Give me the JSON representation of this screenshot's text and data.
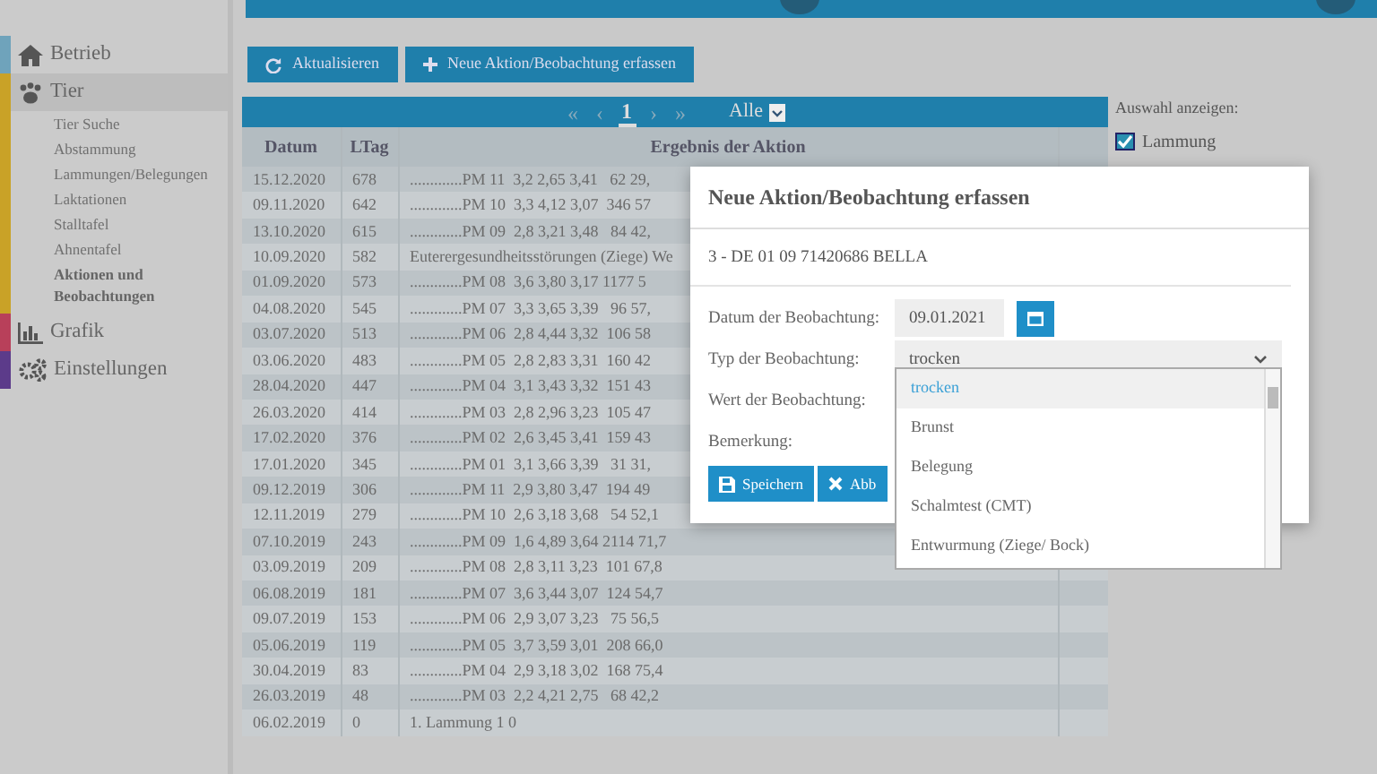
{
  "sidebar": {
    "items": [
      {
        "label": "Betrieb",
        "color": "#6fa3bb",
        "selected": false
      },
      {
        "label": "Tier",
        "color": "#c9a227",
        "selected": true,
        "children": [
          {
            "label": "Tier Suche",
            "selected": false
          },
          {
            "label": "Abstammung",
            "selected": false
          },
          {
            "label": "Lammungen/Belegungen",
            "selected": false
          },
          {
            "label": "Laktationen",
            "selected": false
          },
          {
            "label": "Stalltafel",
            "selected": false
          },
          {
            "label": "Ahnentafel",
            "selected": false
          },
          {
            "label": "Aktionen und Beobachtungen",
            "selected": true
          }
        ]
      },
      {
        "label": "Grafik",
        "color": "#b8405a",
        "selected": false
      },
      {
        "label": "Einstellungen",
        "color": "#5c3b8a",
        "selected": false
      }
    ]
  },
  "toolbar": [
    {
      "label": "Aktualisieren"
    },
    {
      "label": "Neue Aktion/Beobachtung erfassen"
    }
  ],
  "pager": {
    "buttons": [
      {
        "label": "«",
        "selected": false
      },
      {
        "label": "‹",
        "selected": false
      },
      {
        "label": "1",
        "selected": true
      },
      {
        "label": "›",
        "selected": false
      },
      {
        "label": "»",
        "selected": false
      }
    ],
    "filter": "Alle"
  },
  "table": {
    "columns": [
      "Datum",
      "LTag",
      "Ergebnis der Aktion"
    ],
    "rows": [
      [
        "15.12.2020",
        "678",
        ".............PM 11  3,2 2,65 3,41   62 29,"
      ],
      [
        "09.11.2020",
        "642",
        ".............PM 10  3,3 4,12 3,07  346 57"
      ],
      [
        "13.10.2020",
        "615",
        ".............PM 09  2,8 3,21 3,48   84 42,"
      ],
      [
        "10.09.2020",
        "582",
        "Euterergesundheitsstörungen (Ziege) We"
      ],
      [
        "01.09.2020",
        "573",
        ".............PM 08  3,6 3,80 3,17 1177 5"
      ],
      [
        "04.08.2020",
        "545",
        ".............PM 07  3,3 3,65 3,39   96 57,"
      ],
      [
        "03.07.2020",
        "513",
        ".............PM 06  2,8 4,44 3,32  106 58"
      ],
      [
        "03.06.2020",
        "483",
        ".............PM 05  2,8 2,83 3,31  160 42"
      ],
      [
        "28.04.2020",
        "447",
        ".............PM 04  3,1 3,43 3,32  151 43"
      ],
      [
        "26.03.2020",
        "414",
        ".............PM 03  2,8 2,96 3,23  105 47"
      ],
      [
        "17.02.2020",
        "376",
        ".............PM 02  2,6 3,45 3,41  159 43"
      ],
      [
        "17.01.2020",
        "345",
        ".............PM 01  3,1 3,66 3,39   31 31,"
      ],
      [
        "09.12.2019",
        "306",
        ".............PM 11  2,9 3,80 3,47  194 49"
      ],
      [
        "12.11.2019",
        "279",
        ".............PM 10  2,6 3,18 3,68   54 52,1"
      ],
      [
        "07.10.2019",
        "243",
        ".............PM 09  1,6 4,89 3,64 2114 71,7"
      ],
      [
        "03.09.2019",
        "209",
        ".............PM 08  2,8 3,11 3,23  101 67,8"
      ],
      [
        "06.08.2019",
        "181",
        ".............PM 07  3,6 3,44 3,07  124 54,7"
      ],
      [
        "09.07.2019",
        "153",
        ".............PM 06  2,9 3,07 3,23   75 56,5"
      ],
      [
        "05.06.2019",
        "119",
        ".............PM 05  3,7 3,59 3,01  208 66,0"
      ],
      [
        "30.04.2019",
        "83",
        ".............PM 04  2,9 3,18 3,02  168 75,4"
      ],
      [
        "26.03.2019",
        "48",
        ".............PM 03  2,2 4,21 2,75   68 42,2"
      ],
      [
        "06.02.2019",
        "0",
        "1. Lammung 1 0"
      ]
    ]
  },
  "filters": {
    "title": "Auswahl anzeigen:",
    "items": [
      {
        "label": "Lammung",
        "checked": true
      }
    ]
  },
  "modal": {
    "title": "Neue Aktion/Beobachtung erfassen",
    "animal": "3 - DE 01 09 71420686 BELLA",
    "fields": [
      {
        "kind": "date",
        "label": "Datum der Beobachtung:",
        "value": "09.01.2021"
      },
      {
        "kind": "select",
        "label": "Typ der Beobachtung:",
        "value": "trocken"
      },
      {
        "kind": "text",
        "label": "Wert der Beobachtung:"
      },
      {
        "kind": "text",
        "label": "Bemerkung:"
      }
    ],
    "buttons": [
      {
        "label": "Speichern"
      },
      {
        "label": "Abb"
      }
    ],
    "dropdown": [
      {
        "label": "trocken",
        "selected": true
      },
      {
        "label": "Brunst",
        "selected": false
      },
      {
        "label": "Belegung",
        "selected": false
      },
      {
        "label": "Schalmtest (CMT)",
        "selected": false
      },
      {
        "label": "Entwurmung (Ziege/ Bock)",
        "selected": false
      }
    ]
  }
}
